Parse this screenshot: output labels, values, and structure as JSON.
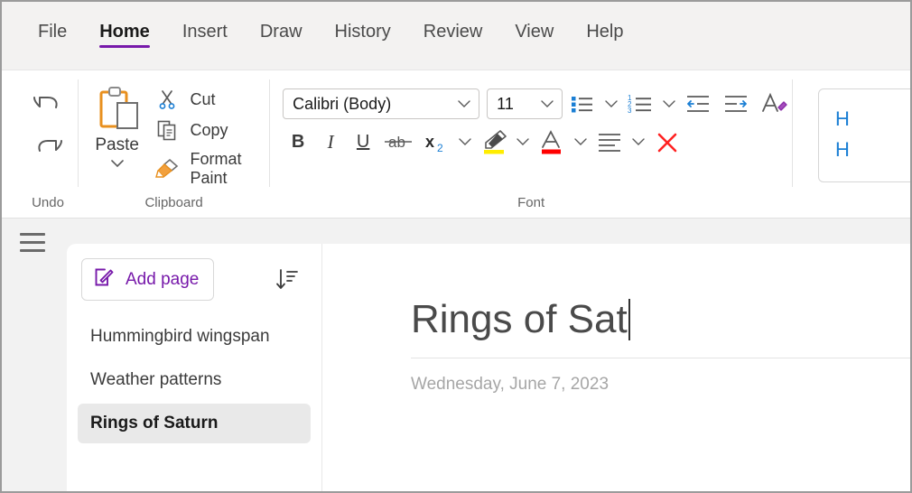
{
  "ribbon": {
    "tabs": [
      {
        "label": "File",
        "active": false
      },
      {
        "label": "Home",
        "active": true
      },
      {
        "label": "Insert",
        "active": false
      },
      {
        "label": "Draw",
        "active": false
      },
      {
        "label": "History",
        "active": false
      },
      {
        "label": "Review",
        "active": false
      },
      {
        "label": "View",
        "active": false
      },
      {
        "label": "Help",
        "active": false
      }
    ],
    "accent_color": "#7719aa",
    "groups": {
      "undo": {
        "label": "Undo",
        "buttons": [
          {
            "name": "undo-icon",
            "title": "Undo"
          },
          {
            "name": "redo-icon",
            "title": "Redo"
          }
        ]
      },
      "clipboard": {
        "label": "Clipboard",
        "paste_label": "Paste",
        "items": [
          {
            "label": "Cut",
            "icon": "scissors-icon"
          },
          {
            "label": "Copy",
            "icon": "copy-icon"
          },
          {
            "label": "Format Paint",
            "icon": "format-painter-icon"
          }
        ]
      },
      "font": {
        "label": "Font",
        "font_name": "Calibri (Body)",
        "font_size": "11",
        "buttons": {
          "bold": "B",
          "italic": "I",
          "underline": "U",
          "strikethrough": "ab",
          "subscript": "x",
          "subscript_sub": "2"
        },
        "highlight_color": "#ffed00",
        "font_color": "#ff0000"
      },
      "styles": {
        "items": [
          "H",
          "H"
        ]
      }
    }
  },
  "workspace": {
    "pagelist": {
      "add_page_label": "Add page",
      "items": [
        {
          "label": "Hummingbird wingspan",
          "selected": false
        },
        {
          "label": "Weather patterns",
          "selected": false
        },
        {
          "label": "Rings of Saturn",
          "selected": true
        }
      ]
    },
    "note": {
      "title": "Rings of Sat",
      "date": "Wednesday, June 7, 2023"
    }
  }
}
